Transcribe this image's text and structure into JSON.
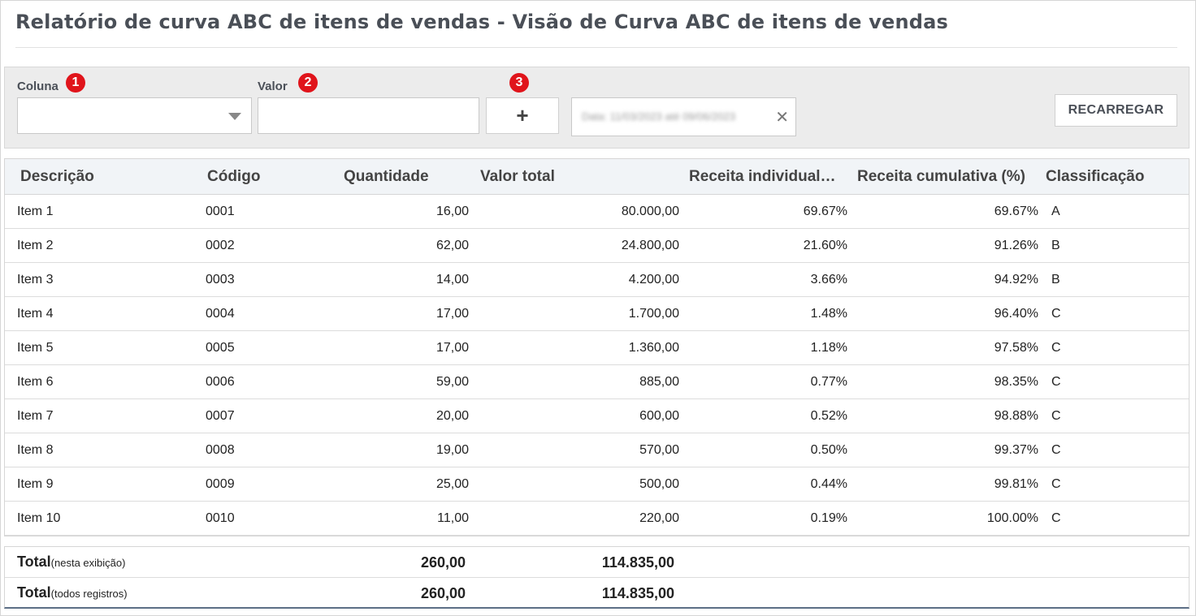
{
  "page": {
    "title": "Relatório de curva ABC de itens de vendas - Visão de Curva ABC de itens de vendas"
  },
  "filters": {
    "column_label": "Coluna",
    "column_badge": "1",
    "column_value": "",
    "value_label": "Valor",
    "value_badge": "2",
    "value_value": "",
    "add_badge": "3",
    "add_label": "+",
    "chip_text": "Data: 11/03/2023 até 09/06/2023",
    "chip_close": "✕",
    "reload_label": "RECARREGAR"
  },
  "table": {
    "headers": [
      "Descrição",
      "Código",
      "Quantidade",
      "Valor total",
      "Receita individual…",
      "Receita cumulativa (%)",
      "Classificação"
    ],
    "rows": [
      [
        "Item 1",
        "0001",
        "16,00",
        "80.000,00",
        "69.67%",
        "69.67%",
        "A"
      ],
      [
        "Item 2",
        "0002",
        "62,00",
        "24.800,00",
        "21.60%",
        "91.26%",
        "B"
      ],
      [
        "Item 3",
        "0003",
        "14,00",
        "4.200,00",
        "3.66%",
        "94.92%",
        "B"
      ],
      [
        "Item 4",
        "0004",
        "17,00",
        "1.700,00",
        "1.48%",
        "96.40%",
        "C"
      ],
      [
        "Item 5",
        "0005",
        "17,00",
        "1.360,00",
        "1.18%",
        "97.58%",
        "C"
      ],
      [
        "Item 6",
        "0006",
        "59,00",
        "885,00",
        "0.77%",
        "98.35%",
        "C"
      ],
      [
        "Item 7",
        "0007",
        "20,00",
        "600,00",
        "0.52%",
        "98.88%",
        "C"
      ],
      [
        "Item 8",
        "0008",
        "19,00",
        "570,00",
        "0.50%",
        "99.37%",
        "C"
      ],
      [
        "Item 9",
        "0009",
        "25,00",
        "500,00",
        "0.44%",
        "99.81%",
        "C"
      ],
      [
        "Item 10",
        "0010",
        "11,00",
        "220,00",
        "0.19%",
        "100.00%",
        "C"
      ]
    ]
  },
  "totals": {
    "view": {
      "label": "Total",
      "sub": "(nesta exibição)",
      "quantity": "260,00",
      "value": "114.835,00"
    },
    "all": {
      "label": "Total",
      "sub": "(todos registros)",
      "quantity": "260,00",
      "value": "114.835,00"
    }
  }
}
